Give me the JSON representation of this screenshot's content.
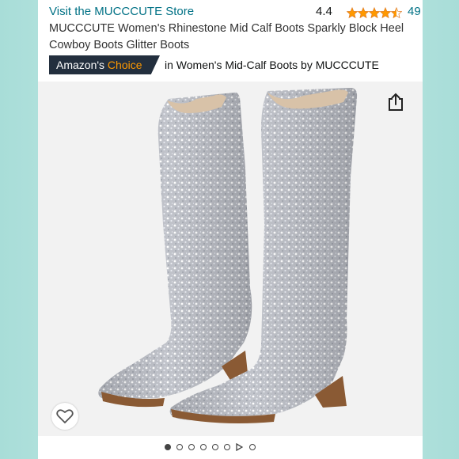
{
  "store": {
    "link_text": "Visit the MUCCCUTE Store"
  },
  "rating": {
    "value": "4.4",
    "count": "49",
    "stars_filled": 4.5,
    "star_color": "#ff9900"
  },
  "product": {
    "title": "MUCCCUTE Women's Rhinestone Mid Calf Boots Sparkly Block Heel Cowboy Boots Glitter Boots"
  },
  "badge": {
    "prefix": "Amazon's",
    "highlight": "Choice",
    "category": "in Women's Mid-Calf Boots by MUCCCUTE",
    "bg_color": "#232f3e",
    "accent_color": "#ff9900"
  },
  "icons": {
    "share": "share-icon",
    "favorite": "heart-icon"
  },
  "carousel": {
    "total": 8,
    "active_index": 0,
    "video_index": 6
  }
}
